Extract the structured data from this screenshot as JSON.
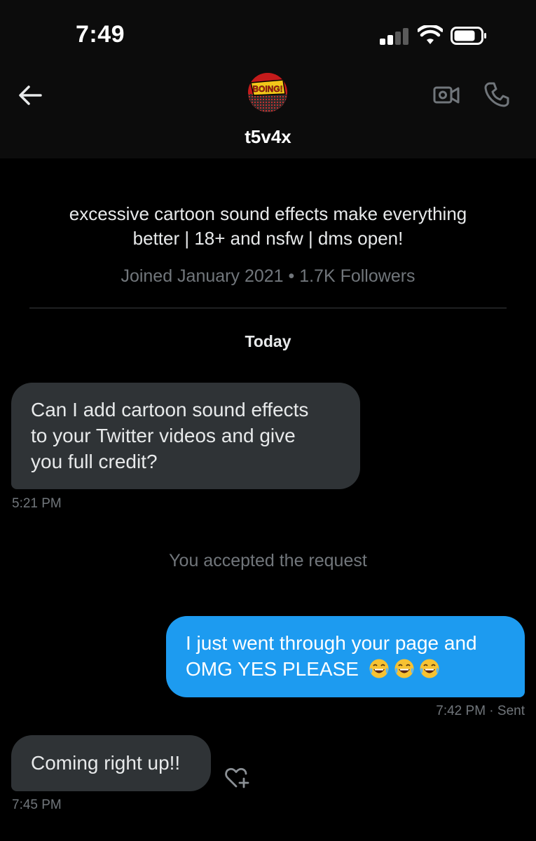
{
  "status_bar": {
    "time": "7:49"
  },
  "header": {
    "username": "t5v4x",
    "avatar_text": "BOING!",
    "icons": [
      "back-arrow-icon",
      "video-call-icon",
      "phone-icon"
    ]
  },
  "profile": {
    "bio_line1": "excessive cartoon sound effects make everything",
    "bio_line2": "better | 18+ and nsfw | dms open!",
    "meta": "Joined January 2021 • 1.7K Followers"
  },
  "conversation": {
    "date_label": "Today",
    "system_message": "You accepted the request",
    "messages": [
      {
        "direction": "incoming",
        "line1": "Can I add cartoon sound effects",
        "line2": "to your Twitter videos and give",
        "line3": "you full credit?",
        "timestamp": "5:21 PM"
      },
      {
        "direction": "outgoing",
        "line1": "I just went through your page and",
        "line2": "OMG YES PLEASE",
        "emoji": "😂😂😂",
        "timestamp": "7:42 PM · Sent"
      },
      {
        "direction": "incoming",
        "line1": "Coming right up!!",
        "timestamp": "7:45 PM"
      }
    ]
  },
  "colors": {
    "background": "#000000",
    "header_bg": "#0c0c0c",
    "incoming_bubble": "#2f3336",
    "outgoing_bubble": "#1d9bf0",
    "muted_text": "#71767b"
  }
}
